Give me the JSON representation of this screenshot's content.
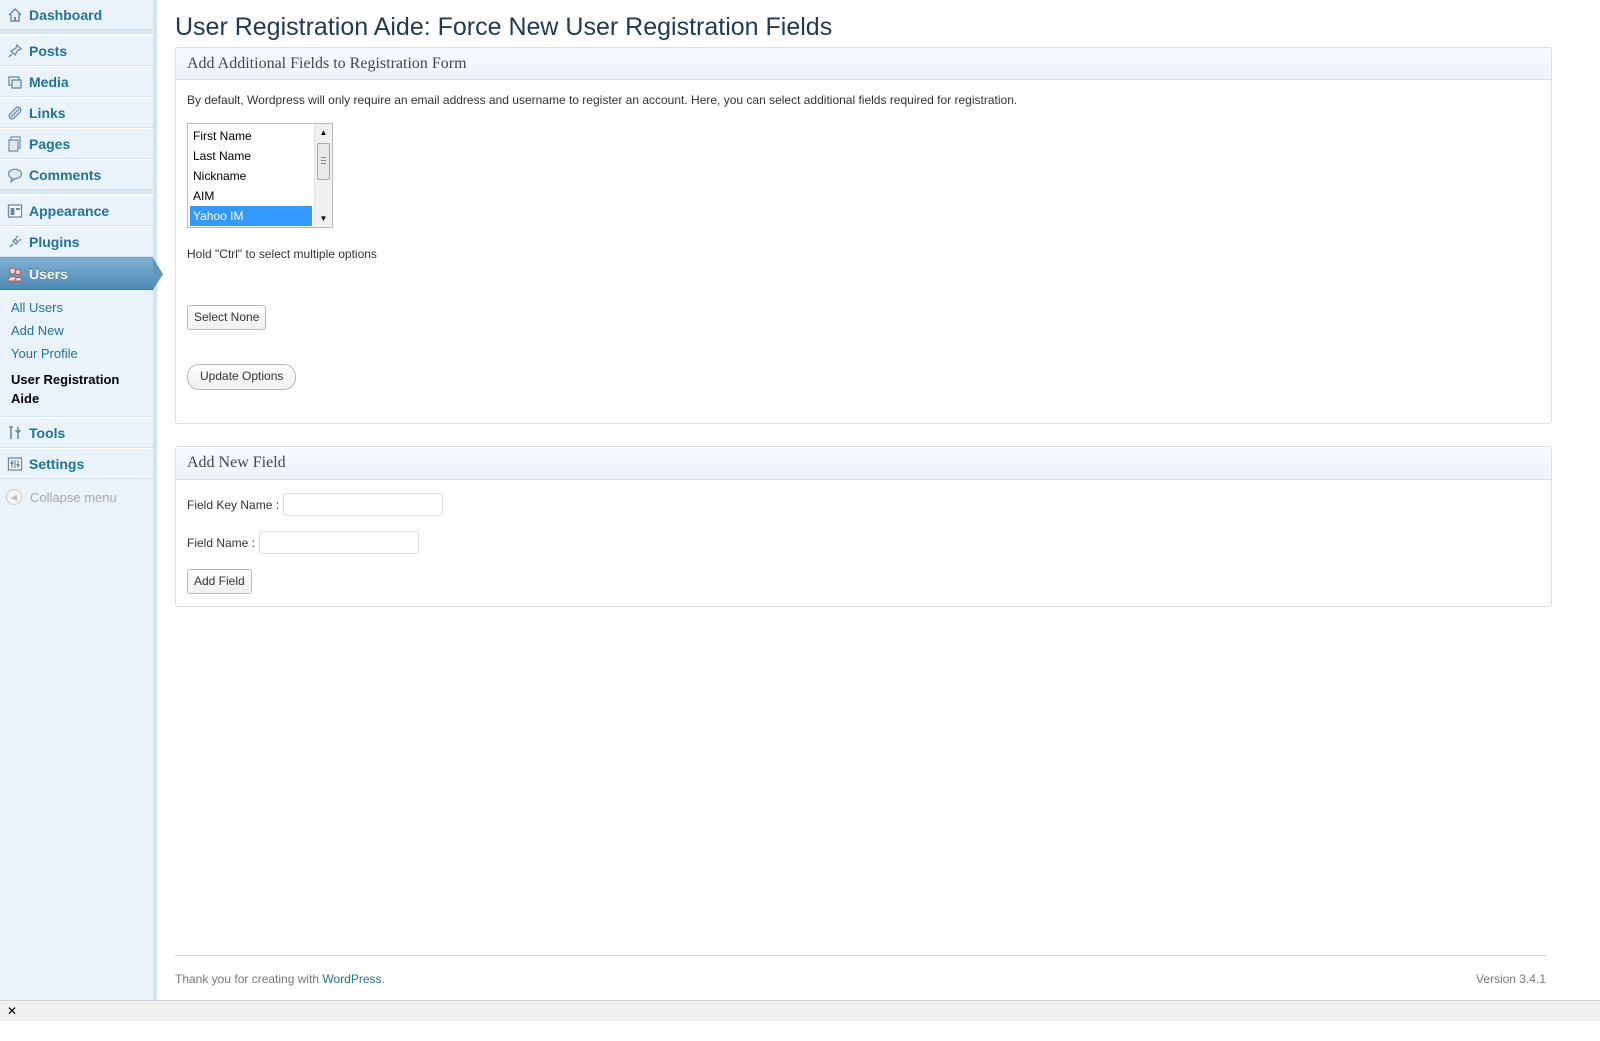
{
  "sidebar": {
    "dashboard": {
      "label": "Dashboard",
      "icon": "house-icon"
    },
    "group1": [
      {
        "label": "Posts",
        "icon": "pin-icon"
      },
      {
        "label": "Media",
        "icon": "media-icon"
      },
      {
        "label": "Links",
        "icon": "link-icon"
      },
      {
        "label": "Pages",
        "icon": "pages-icon"
      },
      {
        "label": "Comments",
        "icon": "speech-bubble-icon"
      }
    ],
    "group2": [
      {
        "label": "Appearance",
        "icon": "appearance-icon"
      },
      {
        "label": "Plugins",
        "icon": "plug-icon"
      }
    ],
    "current": {
      "label": "Users",
      "icon": "users-icon"
    },
    "submenu": [
      {
        "label": "All Users"
      },
      {
        "label": "Add New"
      },
      {
        "label": "Your Profile"
      },
      {
        "label": "User Registration Aide",
        "current": true
      }
    ],
    "group3": [
      {
        "label": "Tools",
        "icon": "tools-icon"
      },
      {
        "label": "Settings",
        "icon": "settings-icon"
      }
    ],
    "collapse_label": "Collapse menu"
  },
  "page": {
    "title": "User Registration Aide: Force New User Registration Fields"
  },
  "box1": {
    "heading": "Add Additional Fields to Registration Form",
    "description": "By default, Wordpress will only require an email address and username to register an account. Here, you can select additional fields required for registration.",
    "options": [
      "First Name",
      "Last Name",
      "Nickname",
      "AIM",
      "Yahoo IM"
    ],
    "selected_option": "Yahoo IM",
    "hint": "Hold \"Ctrl\" to select multiple options",
    "select_none_label": "Select None",
    "update_label": "Update Options"
  },
  "box2": {
    "heading": "Add New Field",
    "key_label": "Field Key Name :",
    "key_value": "",
    "name_label": "Field Name :",
    "name_value": "",
    "add_label": "Add Field"
  },
  "footer": {
    "thanks_prefix": "Thank you for creating with ",
    "link": "WordPress",
    "thanks_suffix": ".",
    "version": "Version 3.4.1"
  },
  "statusbar": {
    "close_glyph": "✕"
  },
  "colors": {
    "accent": "#21759b",
    "current_menu": "#5d96bf",
    "selection": "#3399ff"
  }
}
